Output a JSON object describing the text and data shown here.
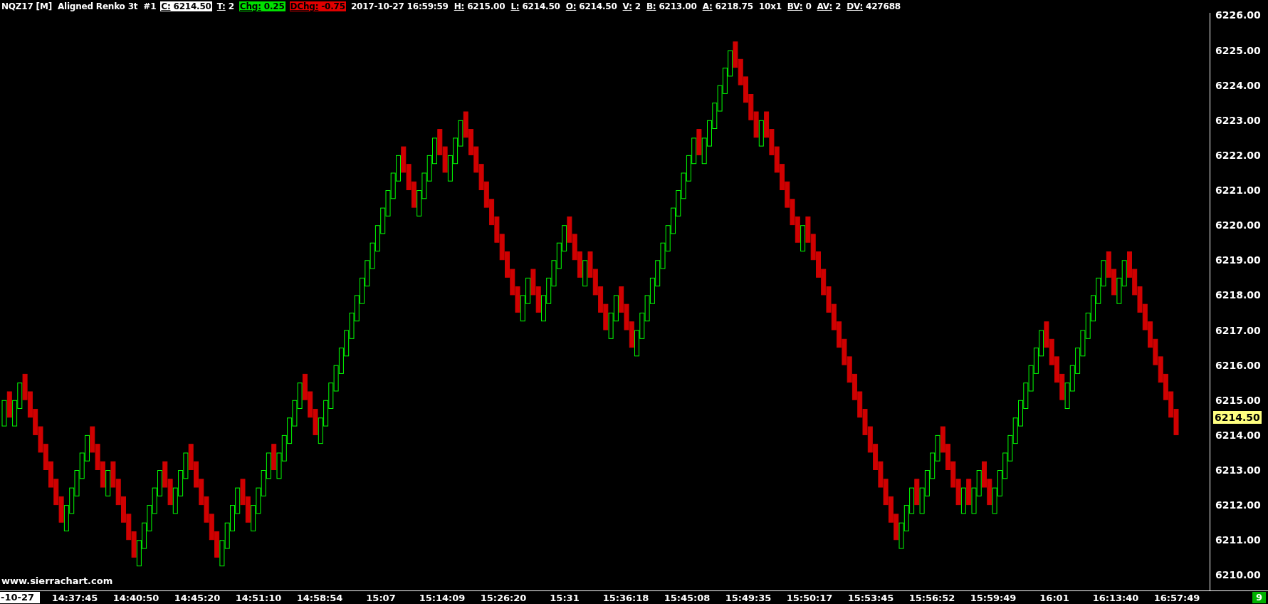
{
  "header": {
    "title": "NQZ17 [M]  Aligned Renko 3t  #1",
    "fields": [
      {
        "label": "C:",
        "value": "6214.50",
        "kind": "inverse"
      },
      {
        "label": "T:",
        "value": "2",
        "kind": "plain"
      },
      {
        "label": "Chg:",
        "value": "0.25",
        "kind": "up"
      },
      {
        "label": "DChg:",
        "value": "-0.75",
        "kind": "down"
      },
      {
        "value": "2017-10-27 16:59:59",
        "kind": "plain"
      },
      {
        "label": "H:",
        "value": "6215.00",
        "kind": "plain"
      },
      {
        "label": "L:",
        "value": "6214.50",
        "kind": "plain"
      },
      {
        "label": "O:",
        "value": "6214.50",
        "kind": "plain"
      },
      {
        "label": "V:",
        "value": "2",
        "kind": "plain"
      },
      {
        "label": "B:",
        "value": "6213.00",
        "kind": "plain"
      },
      {
        "label": "A:",
        "value": "6218.75",
        "kind": "plain"
      },
      {
        "value": "10x1",
        "kind": "plain"
      },
      {
        "label": "BV:",
        "value": "0",
        "kind": "plain"
      },
      {
        "label": "AV:",
        "value": "2",
        "kind": "plain"
      },
      {
        "label": "DV:",
        "value": "427688",
        "kind": "plain"
      }
    ]
  },
  "chart": {
    "watermark_text": "www.sierrachart.com",
    "current_price": "6214.50",
    "price_labels": [
      "6226.00",
      "6225.00",
      "6224.00",
      "6223.00",
      "6222.00",
      "6221.00",
      "6220.00",
      "6219.00",
      "6218.00",
      "6217.00",
      "6216.00",
      "6215.00",
      "6214.00",
      "6213.00",
      "6212.00",
      "6211.00",
      "6210.00"
    ],
    "date_label": "-10-27",
    "time_labels": [
      "14:37:45",
      "14:40:50",
      "14:45:20",
      "14:51:10",
      "14:58:54",
      "15:07",
      "15:14:09",
      "15:26:20",
      "15:31",
      "15:36:18",
      "15:45:08",
      "15:49:35",
      "15:50:17",
      "15:53:45",
      "15:56:52",
      "15:59:49",
      "16:01",
      "16:13:40",
      "16:57:49"
    ],
    "corner_badge": "9"
  }
}
